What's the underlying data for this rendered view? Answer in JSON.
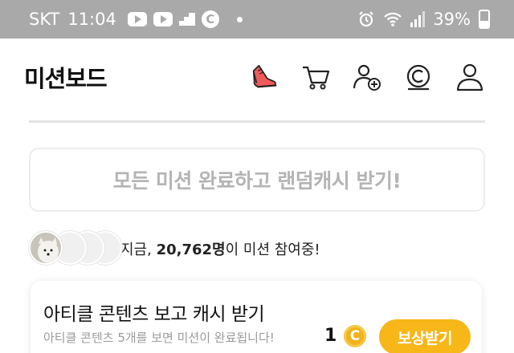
{
  "status_bar": {
    "carrier": "SKT",
    "time": "11:04",
    "battery_percent": "39%",
    "battery_level": 0.39,
    "notification_icons": [
      "youtube-icon",
      "youtube-icon",
      "stairs-icon",
      "cash-c-icon",
      "dot-icon"
    ],
    "system_icons": [
      "alarm-icon",
      "wifi-icon",
      "signal-icon",
      "battery-icon"
    ]
  },
  "header": {
    "title": "미션보드",
    "icons": [
      "sneaker-icon",
      "cart-icon",
      "add-friend-icon",
      "coin-icon",
      "profile-icon"
    ]
  },
  "banner": {
    "text": "모든 미션 완료하고 랜덤캐시 받기!"
  },
  "participants": {
    "prefix": "지금, ",
    "count": "20,762명",
    "suffix": "이 미션 참여중!"
  },
  "mission": {
    "title": "아티클 콘텐츠 보고 캐시 받기",
    "description": "아티클 콘텐츠 5개를 보면 미션이 완료됩니다!",
    "reward_amount": "1",
    "coin_symbol": "C",
    "button_label": "보상받기"
  },
  "colors": {
    "status_bar_bg": "#a9a9a9",
    "accent": "#f7b718",
    "sneaker_red": "#f05a5a",
    "muted_text": "#b4b4b4"
  }
}
